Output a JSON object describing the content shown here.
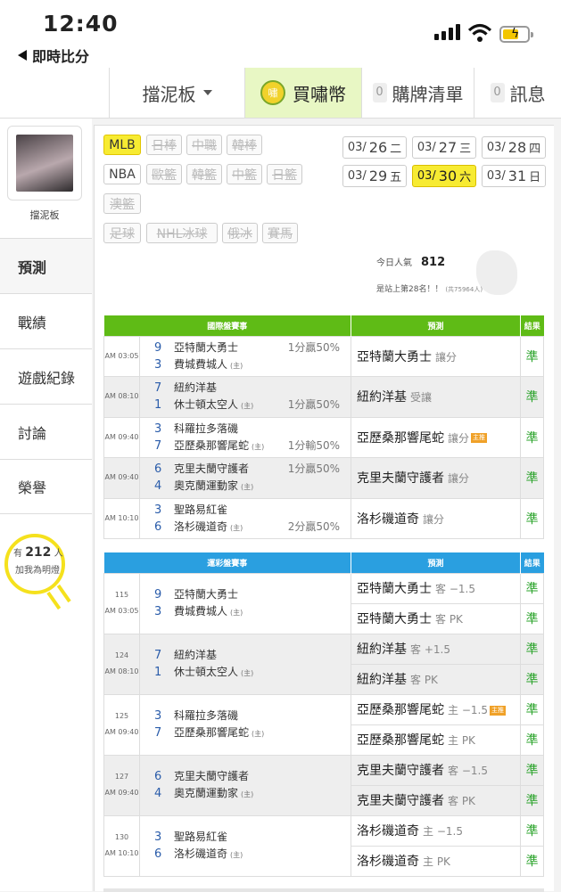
{
  "status": {
    "time": "12:40",
    "back": "即時比分"
  },
  "nav": {
    "user": "擋泥板",
    "coin": "買嘯幣",
    "coin_badge": "嘯",
    "buy_count": "0",
    "buy": "購牌清單",
    "msg_count": "0",
    "msg": "訊息"
  },
  "side": {
    "username": "擋泥板",
    "items": [
      "預測",
      "戰績",
      "遊戲紀錄",
      "討論",
      "榮譽"
    ],
    "bulb_prefix": "有",
    "bulb_count": "212",
    "bulb_suffix": "人",
    "bulb_line2": "加我為明燈"
  },
  "tags": [
    "MLB",
    "日棒",
    "中職",
    "韓棒",
    "NBA",
    "歐籃",
    "韓籃",
    "中籃",
    "日籃",
    "澳籃",
    "足球",
    "NHL冰球",
    "俄冰",
    "賽馬"
  ],
  "dates": [
    {
      "d": "03/",
      "n": "26",
      "w": "二"
    },
    {
      "d": "03/",
      "n": "27",
      "w": "三"
    },
    {
      "d": "03/",
      "n": "28",
      "w": "四"
    },
    {
      "d": "03/",
      "n": "29",
      "w": "五"
    },
    {
      "d": "03/",
      "n": "30",
      "w": "六"
    },
    {
      "d": "03/",
      "n": "31",
      "w": "日"
    }
  ],
  "popularity": {
    "label": "今日人氣",
    "value": "812",
    "rank": "是站上第28名！！",
    "rank_total": "(共75964人)"
  },
  "intl": {
    "headers": [
      "國際盤賽事",
      "預測",
      "結果"
    ],
    "rows": [
      {
        "time": "AM 03:05",
        "away_no": "9",
        "away": "亞特蘭大勇士",
        "away_odds": "1分贏50%",
        "home_no": "3",
        "home": "費城費城人",
        "home_tag": "(主)",
        "home_odds": "",
        "pick": "亞特蘭大勇士",
        "type": "讓分",
        "gold": "",
        "result": "準"
      },
      {
        "time": "AM 08:10",
        "away_no": "7",
        "away": "紐約洋基",
        "away_odds": "",
        "home_no": "1",
        "home": "休士頓太空人",
        "home_tag": "(主)",
        "home_odds": "1分贏50%",
        "pick": "紐約洋基",
        "type": "受讓",
        "gold": "",
        "result": "準"
      },
      {
        "time": "AM 09:40",
        "away_no": "3",
        "away": "科羅拉多落磯",
        "away_odds": "",
        "home_no": "7",
        "home": "亞歷桑那響尾蛇",
        "home_tag": "(主)",
        "home_odds": "1分輸50%",
        "pick": "亞歷桑那響尾蛇",
        "type": "讓分",
        "gold": "主推",
        "result": "準"
      },
      {
        "time": "AM 09:40",
        "away_no": "6",
        "away": "克里夫蘭守護者",
        "away_odds": "1分贏50%",
        "home_no": "4",
        "home": "奧克蘭運動家",
        "home_tag": "(主)",
        "home_odds": "",
        "pick": "克里夫蘭守護者",
        "type": "讓分",
        "gold": "",
        "result": "準"
      },
      {
        "time": "AM 10:10",
        "away_no": "3",
        "away": "聖路易紅雀",
        "away_odds": "",
        "home_no": "6",
        "home": "洛杉磯道奇",
        "home_tag": "(主)",
        "home_odds": "2分贏50%",
        "pick": "洛杉磯道奇",
        "type": "讓分",
        "gold": "",
        "result": "準"
      }
    ]
  },
  "lottery": {
    "headers": [
      "運彩盤賽事",
      "預測",
      "結果"
    ],
    "rows": [
      {
        "no": "115",
        "time": "AM 03:05",
        "away_no": "9",
        "away": "亞特蘭大勇士",
        "home_no": "3",
        "home": "費城費城人",
        "home_tag": "(主)",
        "picks": [
          {
            "team": "亞特蘭大勇士",
            "line": "客 −1.5",
            "gold": "",
            "result": "準"
          },
          {
            "team": "亞特蘭大勇士",
            "line": "客 PK",
            "gold": "",
            "result": "準"
          }
        ]
      },
      {
        "no": "124",
        "time": "AM 08:10",
        "away_no": "7",
        "away": "紐約洋基",
        "home_no": "1",
        "home": "休士頓太空人",
        "home_tag": "(主)",
        "picks": [
          {
            "team": "紐約洋基",
            "line": "客 +1.5",
            "gold": "",
            "result": "準"
          },
          {
            "team": "紐約洋基",
            "line": "客 PK",
            "gold": "",
            "result": "準"
          }
        ]
      },
      {
        "no": "125",
        "time": "AM 09:40",
        "away_no": "3",
        "away": "科羅拉多落磯",
        "home_no": "7",
        "home": "亞歷桑那響尾蛇",
        "home_tag": "(主)",
        "picks": [
          {
            "team": "亞歷桑那響尾蛇",
            "line": "主 −1.5",
            "gold": "主推",
            "result": "準"
          },
          {
            "team": "亞歷桑那響尾蛇",
            "line": "主 PK",
            "gold": "",
            "result": "準"
          }
        ]
      },
      {
        "no": "127",
        "time": "AM 09:40",
        "away_no": "6",
        "away": "克里夫蘭守護者",
        "home_no": "4",
        "home": "奧克蘭運動家",
        "home_tag": "(主)",
        "picks": [
          {
            "team": "克里夫蘭守護者",
            "line": "客 −1.5",
            "gold": "",
            "result": "準"
          },
          {
            "team": "克里夫蘭守護者",
            "line": "客 PK",
            "gold": "",
            "result": "準"
          }
        ]
      },
      {
        "no": "130",
        "time": "AM 10:10",
        "away_no": "3",
        "away": "聖路易紅雀",
        "home_no": "6",
        "home": "洛杉磯道奇",
        "home_tag": "(主)",
        "picks": [
          {
            "team": "洛杉磯道奇",
            "line": "主 −1.5",
            "gold": "",
            "result": "準"
          },
          {
            "team": "洛杉磯道奇",
            "line": "主 PK",
            "gold": "",
            "result": "準"
          }
        ]
      }
    ]
  }
}
